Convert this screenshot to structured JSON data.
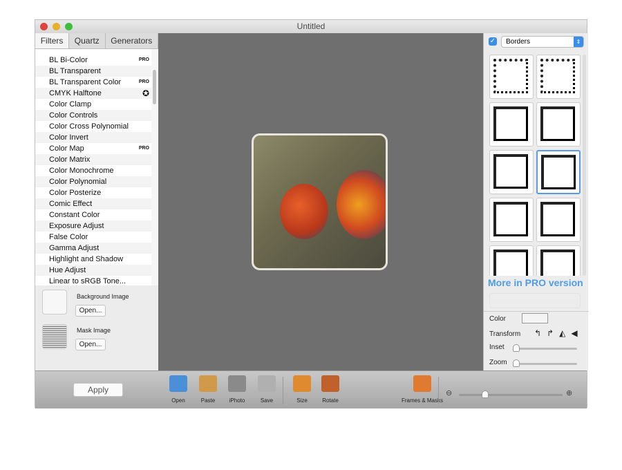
{
  "window": {
    "title": "Untitled"
  },
  "tabs": [
    {
      "label": "Filters"
    },
    {
      "label": "Quartz"
    },
    {
      "label": "Generators"
    }
  ],
  "filters": [
    {
      "label": "BL Bi-Color",
      "badge": "PRO"
    },
    {
      "label": "BL Transparent",
      "badge": ""
    },
    {
      "label": "BL Transparent Color",
      "badge": "PRO"
    },
    {
      "label": "CMYK Halftone",
      "badge": "✪"
    },
    {
      "label": "Color Clamp",
      "badge": ""
    },
    {
      "label": "Color Controls",
      "badge": ""
    },
    {
      "label": "Color Cross Polynomial",
      "badge": ""
    },
    {
      "label": "Color Invert",
      "badge": ""
    },
    {
      "label": "Color Map",
      "badge": "PRO"
    },
    {
      "label": "Color Matrix",
      "badge": ""
    },
    {
      "label": "Color Monochrome",
      "badge": ""
    },
    {
      "label": "Color Polynomial",
      "badge": ""
    },
    {
      "label": "Color Posterize",
      "badge": ""
    },
    {
      "label": "Comic Effect",
      "badge": ""
    },
    {
      "label": "Constant Color",
      "badge": ""
    },
    {
      "label": "Exposure Adjust",
      "badge": ""
    },
    {
      "label": "False Color",
      "badge": ""
    },
    {
      "label": "Gamma Adjust",
      "badge": ""
    },
    {
      "label": "Highlight and Shadow",
      "badge": ""
    },
    {
      "label": "Hue Adjust",
      "badge": ""
    },
    {
      "label": "Linear to sRGB Tone...",
      "badge": ""
    }
  ],
  "sources": {
    "background_label": "Background Image",
    "mask_label": "Mask Image",
    "open_label": "Open..."
  },
  "apply_label": "Apply",
  "right": {
    "checked": true,
    "category": "Borders",
    "pro_text": "More in PRO version",
    "color_label": "Color",
    "transform_label": "Transform",
    "inset_label": "Inset",
    "zoom_label": "Zoom",
    "inset_value": 0,
    "zoom_value": 0
  },
  "toolbar": [
    {
      "label": "Open",
      "icon": "open-icon",
      "color": "#4a8fd8"
    },
    {
      "label": "Paste",
      "icon": "paste-icon",
      "color": "#d09a4a"
    },
    {
      "label": "iPhoto",
      "icon": "iphoto-icon",
      "color": "#8a8a8a"
    },
    {
      "label": "Save",
      "icon": "save-icon",
      "color": "#b0b0b0"
    },
    {
      "label": "Size",
      "icon": "size-icon",
      "color": "#e08a30"
    },
    {
      "label": "Rotate",
      "icon": "rotate-icon",
      "color": "#c0602a"
    },
    {
      "label": "Frames & Masks",
      "icon": "frames-icon",
      "color": "#e07a30"
    }
  ],
  "zoom_slider_value": 0.25
}
